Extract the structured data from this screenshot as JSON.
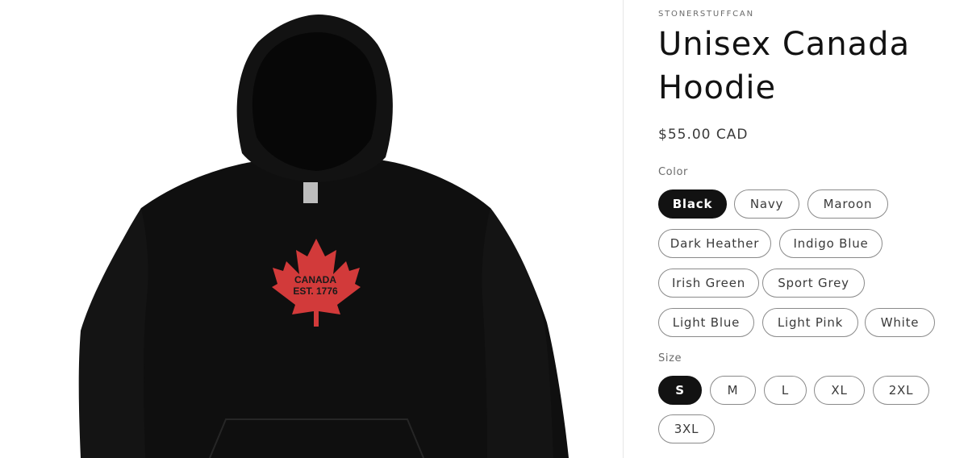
{
  "product": {
    "vendor": "STONERSTUFFCAN",
    "title": "Unisex Canada Hoodie",
    "price": "$55.00 CAD",
    "image": {
      "print_line1": "CANADA",
      "print_line2": "EST. 1776",
      "hoodie_color": "#0f0f0f",
      "leaf_color": "#d23a3a"
    }
  },
  "color_option": {
    "label": "Color",
    "selected": "Black",
    "values": [
      "Black",
      "Navy",
      "Maroon",
      "Dark Heather",
      "Indigo Blue",
      "Irish Green",
      "Sport Grey",
      "Light Blue",
      "Light Pink",
      "White"
    ]
  },
  "size_option": {
    "label": "Size",
    "selected": "S",
    "values": [
      "S",
      "M",
      "L",
      "XL",
      "2XL",
      "3XL"
    ]
  }
}
